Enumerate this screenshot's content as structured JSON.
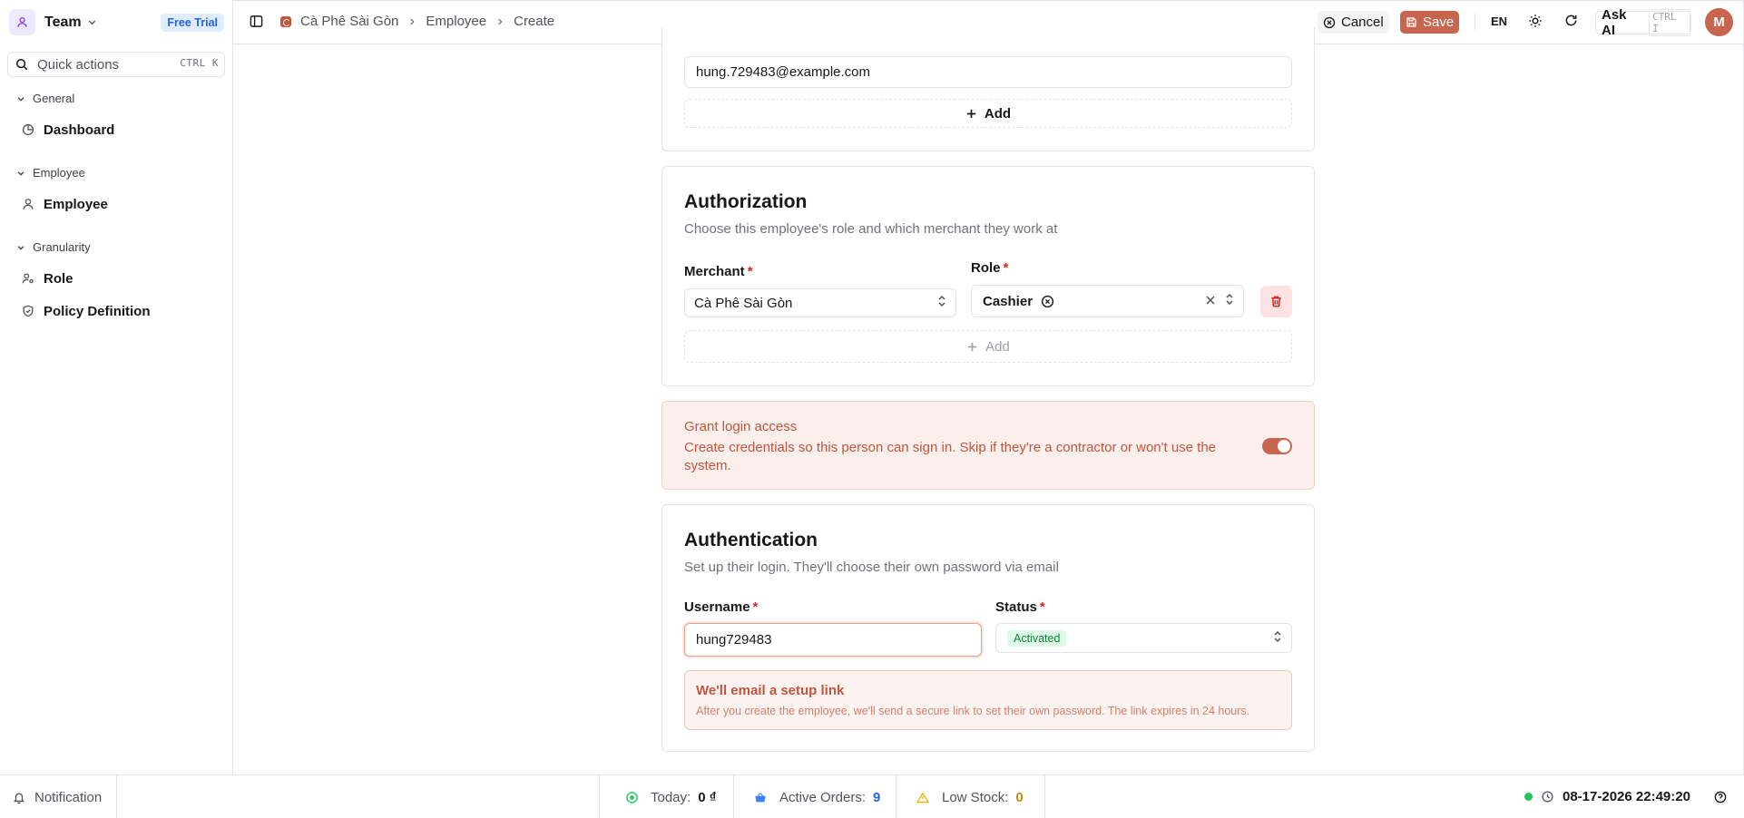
{
  "sidebar": {
    "team_name": "Team",
    "trial_badge": "Free Trial",
    "quick_actions": {
      "label": "Quick actions",
      "shortcut": "CTRL K"
    },
    "groups": [
      {
        "label": "General",
        "items": [
          {
            "label": "Dashboard",
            "icon": "pie-chart-icon"
          }
        ]
      },
      {
        "label": "Employee",
        "items": [
          {
            "label": "Employee",
            "icon": "user-icon"
          }
        ]
      },
      {
        "label": "Granularity",
        "items": [
          {
            "label": "Role",
            "icon": "users-cog-icon"
          },
          {
            "label": "Policy Definition",
            "icon": "shield-icon"
          }
        ]
      }
    ]
  },
  "header": {
    "breadcrumb": [
      "Cà Phê Sài Gòn",
      "Employee",
      "Create"
    ],
    "cancel_label": "Cancel",
    "save_label": "Save",
    "language": "EN",
    "ask_ai": {
      "label": "Ask AI",
      "shortcut": "CTRL I"
    },
    "avatar_initial": "M"
  },
  "contact": {
    "email_value": "hung.729483@example.com",
    "add_label": "Add"
  },
  "authorization": {
    "title": "Authorization",
    "subtitle": "Choose this employee's role and which merchant they work at",
    "merchant_label": "Merchant",
    "merchant_value": "Cà Phê Sài Gòn",
    "role_label": "Role",
    "role_value": "Cashier",
    "add_label": "Add"
  },
  "grant_login": {
    "title": "Grant login access",
    "description": "Create credentials so this person can sign in. Skip if they're a contractor or won't use the system.",
    "enabled": true
  },
  "authentication": {
    "title": "Authentication",
    "subtitle": "Set up their login. They'll choose their own password via email",
    "username_label": "Username",
    "username_value": "hung729483",
    "status_label": "Status",
    "status_value": "Activated",
    "setup_title": "We'll email a setup link",
    "setup_desc": "After you create the employee, we'll send a secure link to set their own password. The link expires in 24 hours."
  },
  "footer": {
    "notification_label": "Notification",
    "today_label": "Today:",
    "today_value": "0 ₫",
    "orders_label": "Active Orders:",
    "orders_value": "9",
    "stock_label": "Low Stock:",
    "stock_value": "0",
    "datetime": "08-17-2026 22:49:20"
  },
  "colors": {
    "accent": "#c8654e",
    "required": "#dc2626",
    "success": "#22c55e",
    "warning": "#eab308",
    "info": "#3b82f6"
  }
}
